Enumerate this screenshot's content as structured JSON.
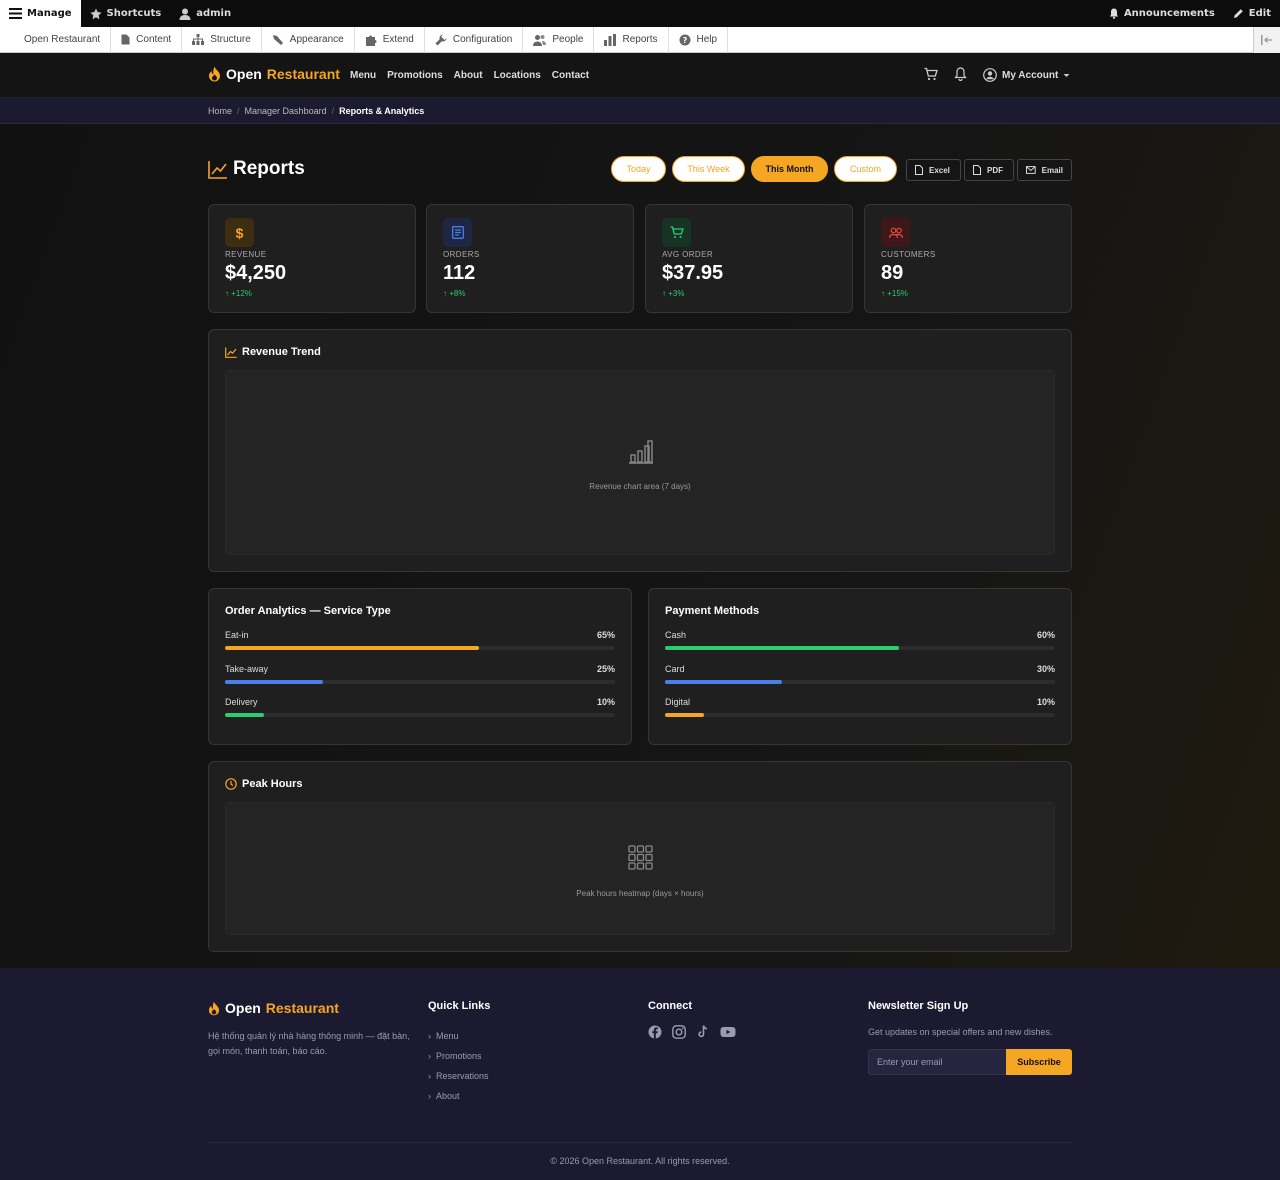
{
  "toolbar": {
    "manage": "Manage",
    "shortcuts": "Shortcuts",
    "user": "admin",
    "announcements": "Announcements",
    "edit": "Edit"
  },
  "tray": [
    "Open Restaurant",
    "Content",
    "Structure",
    "Appearance",
    "Extend",
    "Configuration",
    "People",
    "Reports",
    "Help"
  ],
  "site": {
    "brand_first": "Open",
    "brand_second": "Restaurant",
    "nav": [
      "Menu",
      "Promotions",
      "About",
      "Locations",
      "Contact"
    ],
    "account": "My Account"
  },
  "breadcrumb": {
    "items": [
      "Home",
      "Manager Dashboard"
    ],
    "current": "Reports & Analytics"
  },
  "page": {
    "title": "Reports",
    "periods": [
      {
        "label": "Today",
        "active": false
      },
      {
        "label": "This Week",
        "active": false
      },
      {
        "label": "This Month",
        "active": true
      },
      {
        "label": "Custom",
        "active": false
      }
    ],
    "exports": [
      "Excel",
      "PDF",
      "Email"
    ]
  },
  "stats": [
    {
      "label": "REVENUE",
      "value": "$4,250",
      "change": "↑ +12%",
      "icon": "dollar-icon",
      "color": "#f5a623"
    },
    {
      "label": "ORDERS",
      "value": "112",
      "change": "↑ +8%",
      "icon": "receipt-icon",
      "color": "#4a7ee8"
    },
    {
      "label": "AVG ORDER",
      "value": "$37.95",
      "change": "↑ +3%",
      "icon": "cart-icon",
      "color": "#2ecc71"
    },
    {
      "label": "CUSTOMERS",
      "value": "89",
      "change": "↑ +15%",
      "icon": "users-icon",
      "color": "#e54848"
    }
  ],
  "revenue": {
    "title": "Revenue Trend",
    "placeholder": "Revenue chart area (7 days)"
  },
  "order_analytics": {
    "title": "Order Analytics — Service Type",
    "rows": [
      {
        "name": "Eat-in",
        "percent": "65%",
        "fraction": 0.65,
        "color": "#f5a623"
      },
      {
        "name": "Take-away",
        "percent": "25%",
        "fraction": 0.25,
        "color": "#4a7ee8"
      },
      {
        "name": "Delivery",
        "percent": "10%",
        "fraction": 0.1,
        "color": "#2ecc71"
      }
    ]
  },
  "payment": {
    "title": "Payment Methods",
    "rows": [
      {
        "name": "Cash",
        "percent": "60%",
        "fraction": 0.6,
        "color": "#2ecc71"
      },
      {
        "name": "Card",
        "percent": "30%",
        "fraction": 0.3,
        "color": "#4a7ee8"
      },
      {
        "name": "Digital",
        "percent": "10%",
        "fraction": 0.1,
        "color": "#f5a623"
      }
    ]
  },
  "peak": {
    "title": "Peak Hours",
    "placeholder": "Peak hours heatmap (days × hours)"
  },
  "footer": {
    "description": "Hệ thống quản lý nhà hàng thông minh — đặt bàn, gọi món, thanh toán, báo cáo.",
    "quick_title": "Quick Links",
    "quick_links": [
      "Menu",
      "Promotions",
      "Reservations",
      "About"
    ],
    "connect_title": "Connect",
    "newsletter_title": "Newsletter Sign Up",
    "newsletter_text": "Get updates on special offers and new dishes.",
    "email_placeholder": "Enter your email",
    "subscribe": "Subscribe",
    "copyright": "© 2026 Open Restaurant. All rights reserved."
  }
}
